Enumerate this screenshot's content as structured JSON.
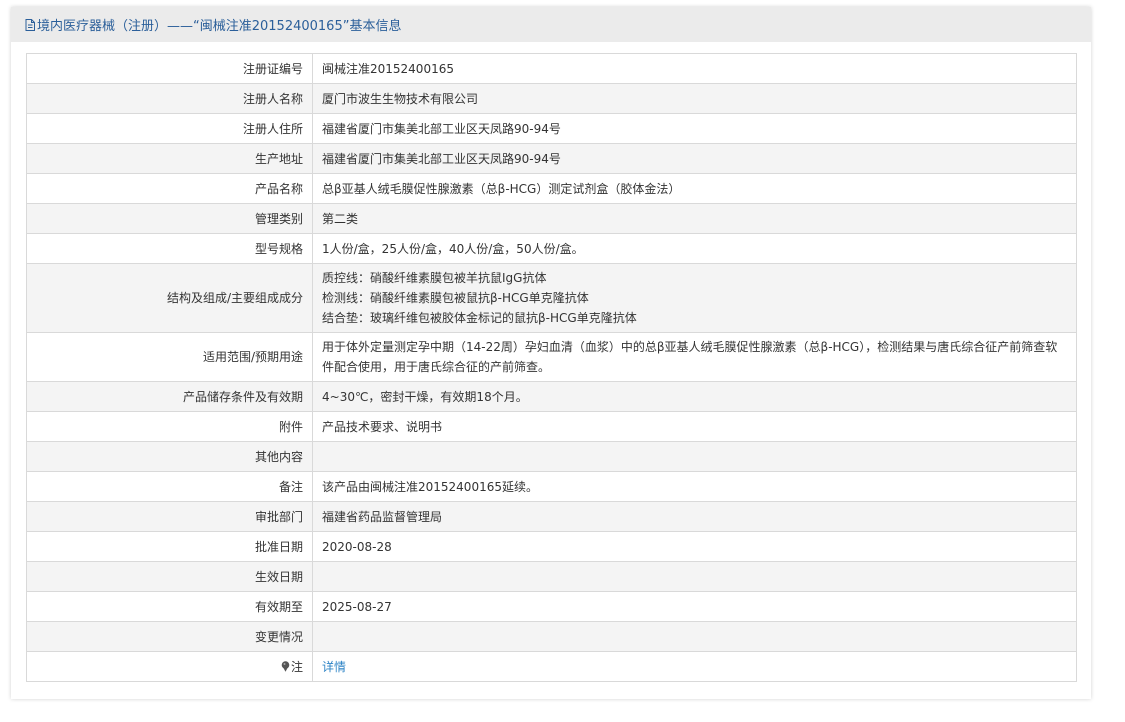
{
  "header": {
    "title": "境内医疗器械（注册）——“闽械注准20152400165”基本信息"
  },
  "rows": [
    {
      "label": "注册证编号",
      "lines": [
        "闽械注准20152400165"
      ]
    },
    {
      "label": "注册人名称",
      "lines": [
        "厦门市波生生物技术有限公司"
      ]
    },
    {
      "label": "注册人住所",
      "lines": [
        "福建省厦门市集美北部工业区天凤路90-94号"
      ]
    },
    {
      "label": "生产地址",
      "lines": [
        "福建省厦门市集美北部工业区天凤路90-94号"
      ]
    },
    {
      "label": "产品名称",
      "lines": [
        "总β亚基人绒毛膜促性腺激素（总β-HCG）测定试剂盒（胶体金法）"
      ]
    },
    {
      "label": "管理类别",
      "lines": [
        "第二类"
      ]
    },
    {
      "label": "型号规格",
      "lines": [
        "1人份/盒，25人份/盒，40人份/盒，50人份/盒。"
      ]
    },
    {
      "label": "结构及组成/主要组成成分",
      "lines": [
        "质控线：硝酸纤维素膜包被羊抗鼠IgG抗体",
        "检测线：硝酸纤维素膜包被鼠抗β-HCG单克隆抗体",
        "结合垫：玻璃纤维包被胶体金标记的鼠抗β-HCG单克隆抗体"
      ]
    },
    {
      "label": "适用范围/预期用途",
      "lines": [
        "用于体外定量测定孕中期（14-22周）孕妇血清（血浆）中的总β亚基人绒毛膜促性腺激素（总β-HCG），检测结果与唐氏综合征产前筛查软件配合使用，用于唐氏综合征的产前筛查。"
      ]
    },
    {
      "label": "产品储存条件及有效期",
      "lines": [
        "4~30℃，密封干燥，有效期18个月。"
      ]
    },
    {
      "label": "附件",
      "lines": [
        "产品技术要求、说明书"
      ]
    },
    {
      "label": "其他内容",
      "lines": [
        ""
      ]
    },
    {
      "label": "备注",
      "lines": [
        "该产品由闽械注准20152400165延续。"
      ]
    },
    {
      "label": "审批部门",
      "lines": [
        "福建省药品监督管理局"
      ]
    },
    {
      "label": "批准日期",
      "lines": [
        "2020-08-28"
      ]
    },
    {
      "label": "生效日期",
      "lines": [
        ""
      ]
    },
    {
      "label": "有效期至",
      "lines": [
        "2025-08-27"
      ]
    },
    {
      "label": "变更情况",
      "lines": [
        ""
      ]
    }
  ],
  "note_row": {
    "label": "注",
    "link_text": "详情",
    "icon": "pin-icon"
  },
  "colors": {
    "header_text": "#2b5f9a",
    "link": "#2e84c6",
    "alt_row": "#f4f4f4",
    "border": "#d9d9d9"
  }
}
